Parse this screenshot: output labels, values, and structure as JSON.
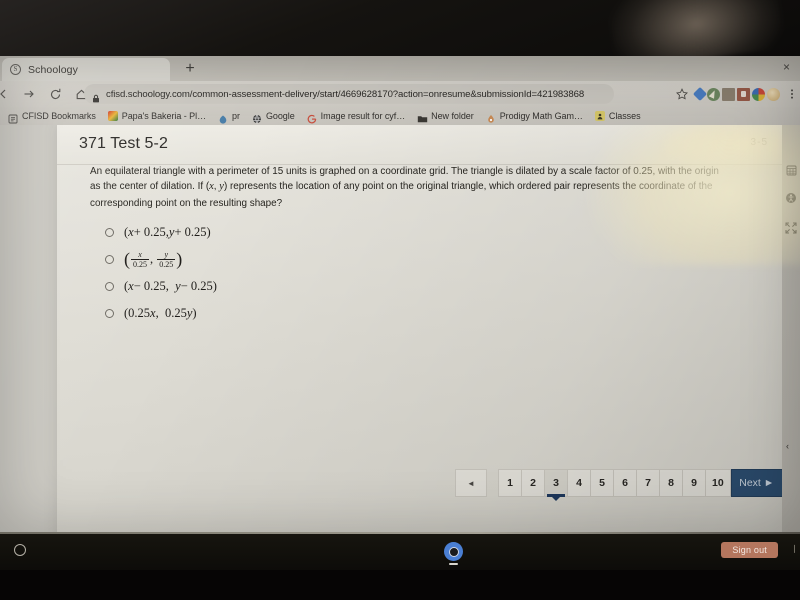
{
  "browser": {
    "tab": {
      "title": "Schoology",
      "favicon_name": "schoology-favicon",
      "close_label": "×",
      "new_tab_label": "+"
    },
    "nav": {
      "back_label": "←",
      "forward_label": "→",
      "reload_label": "⟳",
      "home_label": "⌂"
    },
    "omnibox": {
      "url": "cfisd.schoology.com/common-assessment-delivery/start/4669628170?action=onresume&submissionId=421983868",
      "secure_icon": "lock-icon",
      "star_icon": "bookmark-star-icon"
    },
    "toolbar_icons": [
      "bookmark-star-icon",
      "blue-diamond-extension-icon",
      "compass-extension-icon",
      "save-page-extension-icon",
      "lastpass-lock-extension-icon",
      "color-extension-icon",
      "profile-avatar-icon",
      "menu-icon"
    ],
    "bookmarks": [
      {
        "label": "CFISD Bookmarks",
        "icon": "bookmark-folder-list-icon"
      },
      {
        "label": "Papa's Bakeria - Pl…",
        "icon": "papas-bakeria-icon"
      },
      {
        "label": "pr",
        "icon": "prodigy-icon"
      },
      {
        "label": "Google",
        "icon": "google-globe-icon"
      },
      {
        "label": "Image result for cyf…",
        "icon": "google-g-icon"
      },
      {
        "label": "New folder",
        "icon": "folder-icon"
      },
      {
        "label": "Prodigy Math Gam…",
        "icon": "prodigy-wizard-icon"
      },
      {
        "label": "Classes",
        "icon": "classes-icon"
      }
    ]
  },
  "assessment": {
    "title": "371 Test 5-2",
    "header_code": "3-5",
    "question": {
      "part1": "An equilateral triangle with a perimeter of 15 units is graphed on a coordinate grid.  The triangle is dilated by a scale factor of 0.25, with the origin as the center of dilation.  If (",
      "var_x": "x",
      "comma": ", ",
      "var_y": "y",
      "part2": ") represents the location of any point on the original triangle, which ordered pair represents the coordinate of the corresponding point on the resulting shape?"
    },
    "choices": [
      {
        "id": "a",
        "text": "(x + 0.25, y + 0.25)",
        "selected": false
      },
      {
        "id": "b",
        "text": "(x/0.25, y/0.25)",
        "selected": false
      },
      {
        "id": "c",
        "text": "(x − 0.25, y − 0.25)",
        "selected": false
      },
      {
        "id": "d",
        "text": "(0.25x, 0.25y)",
        "selected": false
      }
    ],
    "pagination": {
      "prev_label": "◄",
      "pages": [
        "1",
        "2",
        "3",
        "4",
        "5",
        "6",
        "7",
        "8",
        "9",
        "10"
      ],
      "active_page": "3",
      "next_label": "Next ►",
      "next_color": "#2d4f72",
      "active_underline_color": "#1f3a5f"
    },
    "rail": {
      "icons": [
        "calculator-icon",
        "accessibility-info-icon",
        "fullscreen-expand-icon"
      ],
      "collapse_label": "‹"
    }
  },
  "shelf": {
    "launcher_icon": "launcher-circle-icon",
    "apps": [
      {
        "name": "chrome-icon"
      }
    ],
    "sign_out_label": "Sign out",
    "sign_out_color": "#b4765e",
    "edge_label": "❘"
  }
}
